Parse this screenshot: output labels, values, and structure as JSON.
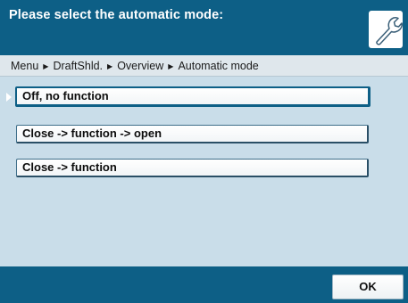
{
  "header": {
    "title": "Please select the automatic mode:",
    "tool_icon": "wrench-icon"
  },
  "breadcrumb": {
    "items": [
      "Menu",
      "DraftShld.",
      "Overview",
      "Automatic mode"
    ],
    "separator_icon": "triangle-right-icon"
  },
  "options": [
    {
      "label": "Off, no function",
      "selected": true
    },
    {
      "label": "Close -> function -> open",
      "selected": false
    },
    {
      "label": "Close -> function",
      "selected": false
    }
  ],
  "footer": {
    "ok_label": "OK"
  },
  "colors": {
    "header_bg": "#0d5f86",
    "content_bg": "#c9dde9",
    "breadcrumb_bg": "#dfe7ec"
  }
}
